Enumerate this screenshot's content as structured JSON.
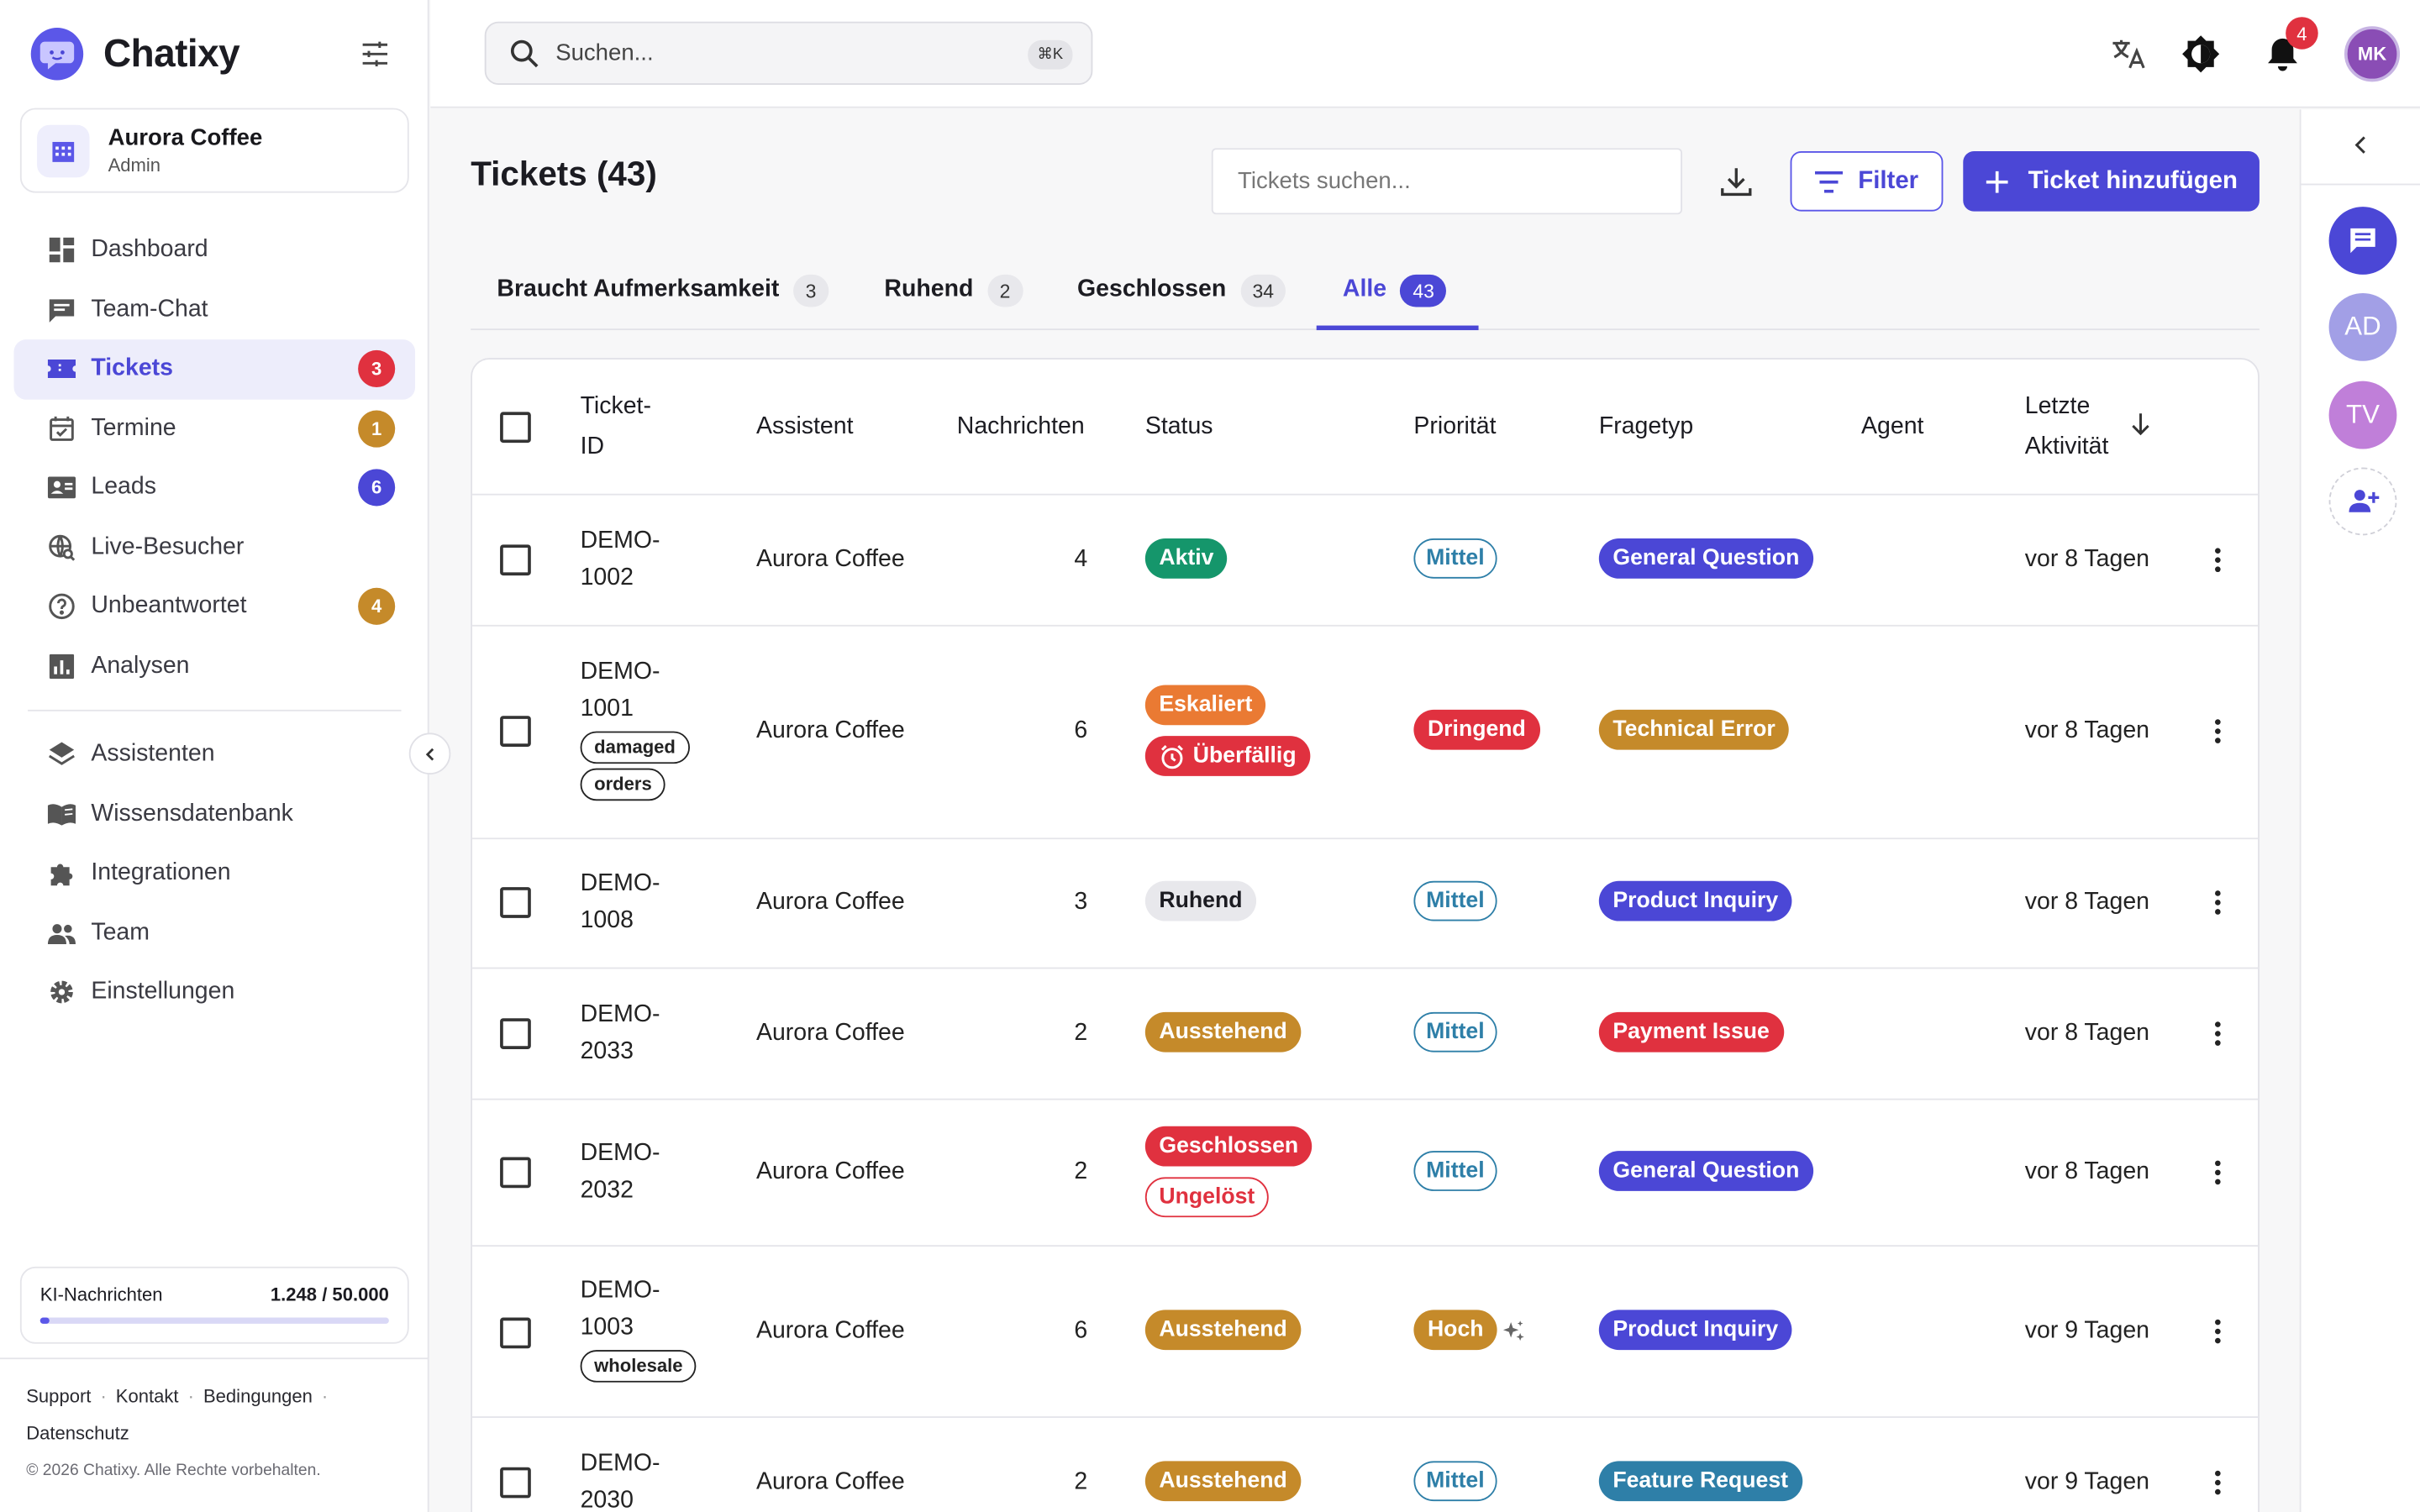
{
  "app": {
    "name": "Chatixy"
  },
  "org": {
    "name": "Aurora Coffee",
    "role": "Admin"
  },
  "sidebar": {
    "items": [
      {
        "label": "Dashboard",
        "icon": "dashboard-icon"
      },
      {
        "label": "Team-Chat",
        "icon": "chat-icon"
      },
      {
        "label": "Tickets",
        "icon": "ticket-icon",
        "badge": "3",
        "badge_color": "#e0313f",
        "active": true
      },
      {
        "label": "Termine",
        "icon": "calendar-icon",
        "badge": "1",
        "badge_color": "#c58a2a"
      },
      {
        "label": "Leads",
        "icon": "contact-card-icon",
        "badge": "6",
        "badge_color": "#4b47d6"
      },
      {
        "label": "Live-Besucher",
        "icon": "live-visitor-icon"
      },
      {
        "label": "Unbeantwortet",
        "icon": "question-icon",
        "badge": "4",
        "badge_color": "#c58a2a"
      },
      {
        "label": "Analysen",
        "icon": "analytics-icon"
      }
    ],
    "items2": [
      {
        "label": "Assistenten",
        "icon": "layers-icon"
      },
      {
        "label": "Wissensdatenbank",
        "icon": "book-icon"
      },
      {
        "label": "Integrationen",
        "icon": "puzzle-icon"
      },
      {
        "label": "Team",
        "icon": "team-icon"
      },
      {
        "label": "Einstellungen",
        "icon": "gear-icon"
      }
    ],
    "quota": {
      "label": "KI-Nachrichten",
      "value": "1.248 / 50.000",
      "fraction": 0.025
    },
    "footer": {
      "support": "Support",
      "contact": "Kontakt",
      "terms": "Bedingungen",
      "privacy": "Datenschutz",
      "copyright": "© 2026 Chatixy. Alle Rechte vorbehalten."
    }
  },
  "header": {
    "search_placeholder": "Suchen...",
    "shortcut": "⌘K",
    "notifications": "4",
    "avatar": "MK"
  },
  "rail": {
    "ad": "AD",
    "tv": "TV"
  },
  "page": {
    "title": "Tickets (43)",
    "search_placeholder": "Tickets suchen...",
    "filter_label": "Filter",
    "add_label": "Ticket hinzufügen",
    "tabs": [
      {
        "label": "Braucht Aufmerksamkeit",
        "count": "3"
      },
      {
        "label": "Ruhend",
        "count": "2"
      },
      {
        "label": "Geschlossen",
        "count": "34"
      },
      {
        "label": "Alle",
        "count": "43",
        "active": true
      }
    ],
    "columns": {
      "id1": "Ticket-",
      "id2": "ID",
      "assistant": "Assistent",
      "messages": "Nachrichten",
      "status": "Status",
      "priority": "Priorität",
      "type": "Fragetyp",
      "agent": "Agent",
      "activity1": "Letzte",
      "activity2": "Aktivität"
    },
    "rows": [
      {
        "id1": "DEMO-",
        "id2": "1002",
        "tags": [],
        "assistant": "Aurora Coffee",
        "messages": "4",
        "status": [
          "Aktiv"
        ],
        "priority": "Mittel",
        "type": "General Question",
        "activity": "vor 8 Tagen"
      },
      {
        "id1": "DEMO-",
        "id2": "1001",
        "tags": [
          "damaged",
          "orders"
        ],
        "assistant": "Aurora Coffee",
        "messages": "6",
        "status": [
          "Eskaliert",
          "Überfällig"
        ],
        "priority": "Dringend",
        "type": "Technical Error",
        "activity": "vor 8 Tagen"
      },
      {
        "id1": "DEMO-",
        "id2": "1008",
        "tags": [],
        "assistant": "Aurora Coffee",
        "messages": "3",
        "status": [
          "Ruhend"
        ],
        "priority": "Mittel",
        "type": "Product Inquiry",
        "activity": "vor 8 Tagen"
      },
      {
        "id1": "DEMO-",
        "id2": "2033",
        "tags": [],
        "assistant": "Aurora Coffee",
        "messages": "2",
        "status": [
          "Ausstehend"
        ],
        "priority": "Mittel",
        "type": "Payment Issue",
        "activity": "vor 8 Tagen"
      },
      {
        "id1": "DEMO-",
        "id2": "2032",
        "tags": [],
        "assistant": "Aurora Coffee",
        "messages": "2",
        "status": [
          "Geschlossen",
          "Ungelöst"
        ],
        "priority": "Mittel",
        "type": "General Question",
        "activity": "vor 8 Tagen"
      },
      {
        "id1": "DEMO-",
        "id2": "1003",
        "tags": [
          "wholesale"
        ],
        "assistant": "Aurora Coffee",
        "messages": "6",
        "status": [
          "Ausstehend"
        ],
        "priority": "Hoch",
        "type": "Product Inquiry",
        "activity": "vor 9 Tagen"
      },
      {
        "id1": "DEMO-",
        "id2": "2030",
        "tags": [],
        "assistant": "Aurora Coffee",
        "messages": "2",
        "status": [
          "Ausstehend"
        ],
        "priority": "Mittel",
        "type": "Feature Request",
        "activity": "vor 9 Tagen"
      }
    ]
  },
  "colors": {
    "accent": "#4b47d6",
    "aktiv": "#15966b",
    "eskaliert": "#ea7a33",
    "dringend": "#e0313f",
    "ausstehend": "#c58a2a",
    "technical": "#c58a2a",
    "payment": "#e0313f",
    "feature": "#2e7fa8",
    "mittel": "#2e7fa8"
  }
}
